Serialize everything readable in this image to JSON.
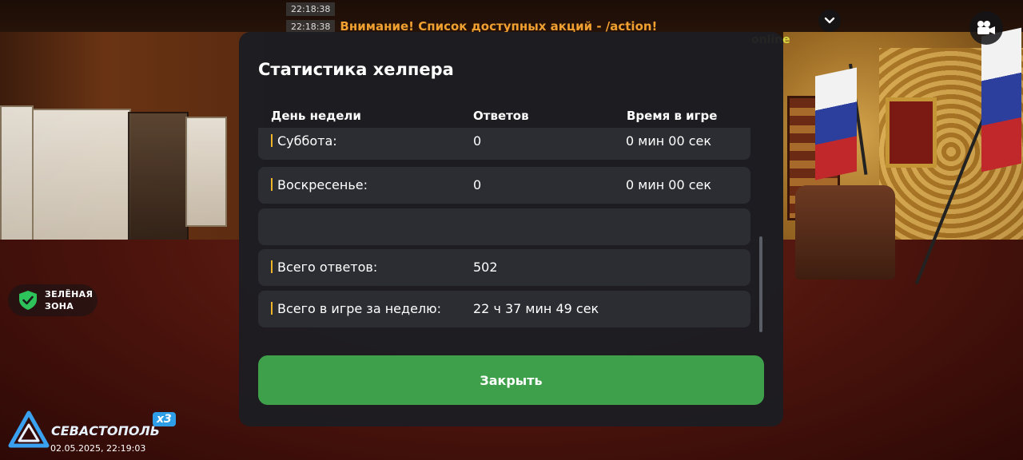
{
  "chat": {
    "lines": [
      {
        "time": "22:18:38",
        "text": ""
      },
      {
        "time": "22:18:38",
        "text": "Внимание! Список доступных акций - /action!"
      }
    ],
    "faint_tail": "online"
  },
  "zone": {
    "label": "ЗЕЛЁНАЯ\nЗОНА",
    "color": "#2ec25a"
  },
  "server": {
    "city": "СЕВАСТОПОЛЬ",
    "multiplier": "x3",
    "datetime": "02.05.2025, 22:19:03"
  },
  "dialog": {
    "title": "Статистика хелпера",
    "headers": {
      "day": "День недели",
      "answers": "Ответов",
      "time": "Время в игре"
    },
    "rows": [
      {
        "day": "Суббота:",
        "answers": "0",
        "time": "0 мин 00 сек"
      },
      {
        "day": "Воскресенье:",
        "answers": "0",
        "time": "0 мин 00 сек"
      },
      {
        "day": "",
        "answers": "",
        "time": ""
      },
      {
        "day": "Всего ответов:",
        "answers": "502",
        "time": ""
      },
      {
        "day": "Всего в игре за неделю:",
        "answers": "22 ч 37 мин 49 сек",
        "time": ""
      }
    ],
    "close_label": "Закрыть",
    "accent": "#f0b428",
    "button_color": "#3ea04a"
  },
  "icons": {
    "chevron": "chevron-down-icon",
    "camera": "camera-icon",
    "shield": "shield-check-icon"
  }
}
